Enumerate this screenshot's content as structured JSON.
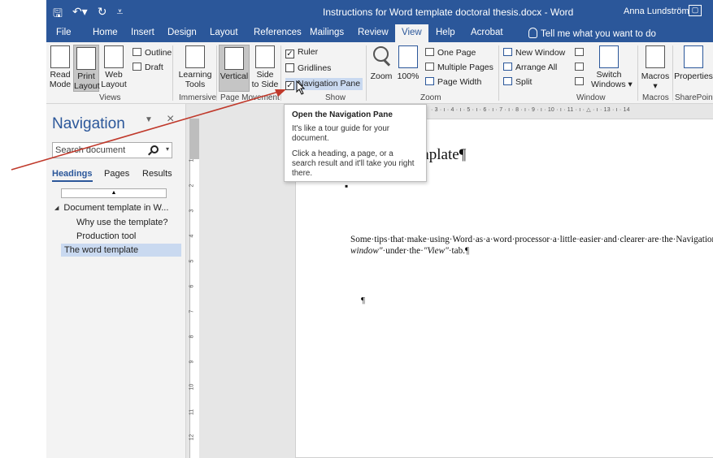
{
  "titlebar": {
    "doc_title": "Instructions for Word template doctoral thesis.docx - Word",
    "user_name": "Anna Lundström",
    "save_icon": "save-icon",
    "undo_icon": "undo-icon",
    "redo_icon": "redo-icon"
  },
  "tabs": [
    {
      "label": "File"
    },
    {
      "label": "Home"
    },
    {
      "label": "Insert"
    },
    {
      "label": "Design"
    },
    {
      "label": "Layout"
    },
    {
      "label": "References"
    },
    {
      "label": "Mailings"
    },
    {
      "label": "Review"
    },
    {
      "label": "View"
    },
    {
      "label": "Help"
    },
    {
      "label": "Acrobat"
    }
  ],
  "tell_me": "Tell me what you want to do",
  "ribbon": {
    "read_mode": "Read Mode",
    "read_l1": "Read",
    "read_l2": "Mode",
    "print_l1": "Print",
    "print_l2": "Layout",
    "web_l1": "Web",
    "web_l2": "Layout",
    "outline": "Outline",
    "draft": "Draft",
    "views_group": "Views",
    "learning_l1": "Learning",
    "learning_l2": "Tools",
    "immersive_group": "Immersive",
    "vertical": "Vertical",
    "side_l1": "Side",
    "side_l2": "to Side",
    "page_movement_group": "Page Movement",
    "ruler": "Ruler",
    "gridlines": "Gridlines",
    "navigation_pane": "Navigation Pane",
    "show_group": "Show",
    "zoom": "Zoom",
    "zoom100": "100%",
    "one_page": "One Page",
    "multiple_pages": "Multiple Pages",
    "page_width": "Page Width",
    "zoom_group": "Zoom",
    "new_window": "New Window",
    "arrange_all": "Arrange All",
    "split": "Split",
    "switch_l1": "Switch",
    "switch_l2": "Windows",
    "window_group": "Window",
    "macros": "Macros",
    "macros_group": "Macros",
    "properties": "Properties",
    "sharepoint_group": "SharePoint"
  },
  "nav": {
    "title": "Navigation",
    "search_placeholder": "Search document",
    "tab_headings": "Headings",
    "tab_pages": "Pages",
    "tab_results": "Results",
    "items": [
      {
        "label": "Document template in W..."
      },
      {
        "label": "Why use the template?"
      },
      {
        "label": "Production tool"
      },
      {
        "label": "The word template"
      }
    ]
  },
  "ruler": {
    "h_marks": "· 3 · ı · 4 · ı · 5 · ı · 6 · ı · 7 · ı · 8 · ı · 9 · ı · 10 · ı · 11 · ı · △ · ı · 13 · ı · 14",
    "v_marks": [
      "1",
      "2",
      "3",
      "4",
      "5",
      "6",
      "7",
      "8",
      "9",
      "10",
      "11",
      "12"
    ]
  },
  "document": {
    "heading": "mplate¶",
    "bullet": "▪",
    "body_text": "Some·tips·that·make·using·Word·as·a·word·processor·a·little·easier·and·clearer·are·the·Navigation·menu·on·the·left·in·the·picture·below.·It·gives·you·a·good·overview·of·the·entire·document·in·different·views·such·as·Headings·and·Pages.·There·is·also·a·good·search·function.·Open·the·Navigation·window·by·checking·the·box·",
    "body_em1": "\"Navigation-window\"",
    "body_mid": "·under·the·",
    "body_em2": "\"View\"",
    "body_end": "·tab.¶",
    "para_mark": "¶"
  },
  "tooltip": {
    "title": "Open the Navigation Pane",
    "line1": "It's like a tour guide for your document.",
    "line2": "Click a heading, a page, or a search result and it'll take you right there."
  },
  "colors": {
    "word_blue": "#2b579a",
    "arrow_red": "#c0392b"
  }
}
